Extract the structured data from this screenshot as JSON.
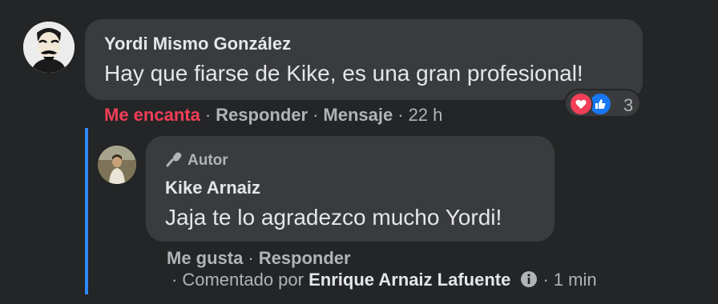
{
  "comment": {
    "author": "Yordi Mismo González",
    "text": "Hay que fiarse de Kike, es una gran profesional!",
    "reaction_count": "3",
    "actions": {
      "love": "Me encanta",
      "reply": "Responder",
      "message": "Mensaje",
      "time": "22 h"
    }
  },
  "reply": {
    "badge": "Autor",
    "author": "Kike Arnaiz",
    "text": "Jaja te lo agradezco mucho Yordi!",
    "actions": {
      "like": "Me gusta",
      "reply": "Responder"
    },
    "commented_by_label": "Comentado por",
    "commented_by_name": "Enrique Arnaiz Lafuente",
    "time": "1 min"
  },
  "colors": {
    "background": "#242526",
    "bubble": "#3a3b3c",
    "love": "#f33e58",
    "like": "#1877f2",
    "thread": "#2d88ff"
  },
  "icons": [
    "love-reaction-icon",
    "like-reaction-icon",
    "microphone-icon",
    "info-icon"
  ]
}
